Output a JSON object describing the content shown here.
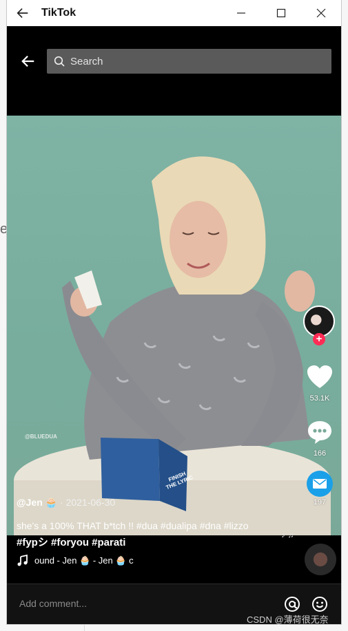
{
  "window": {
    "title": "TikTok"
  },
  "search": {
    "placeholder": "Search"
  },
  "post": {
    "author": "@Jen 🧁",
    "date_sep": " · ",
    "date": "2021-06-30",
    "description": "she's a 100% THAT b*tch !! #dua #dualipa #dna #lizzo",
    "hashtags_line2": "#fypシ #foryou #parati",
    "sound": "ound - Jen 🧁 - Jen 🧁   c",
    "likes": "53.1K",
    "comments": "166",
    "shares": "197",
    "video_overlay_handle": "@BLUEDUA",
    "box_text_line1": "FINISH",
    "box_text_line2": "THE LYRIC"
  },
  "comment_input": {
    "placeholder": "Add comment..."
  },
  "watermark": "CSDN @薄荷很无奈",
  "colors": {
    "accent_red": "#fe2c55",
    "share_blue": "#1aa0e8",
    "search_bg": "#5a5a5a"
  }
}
